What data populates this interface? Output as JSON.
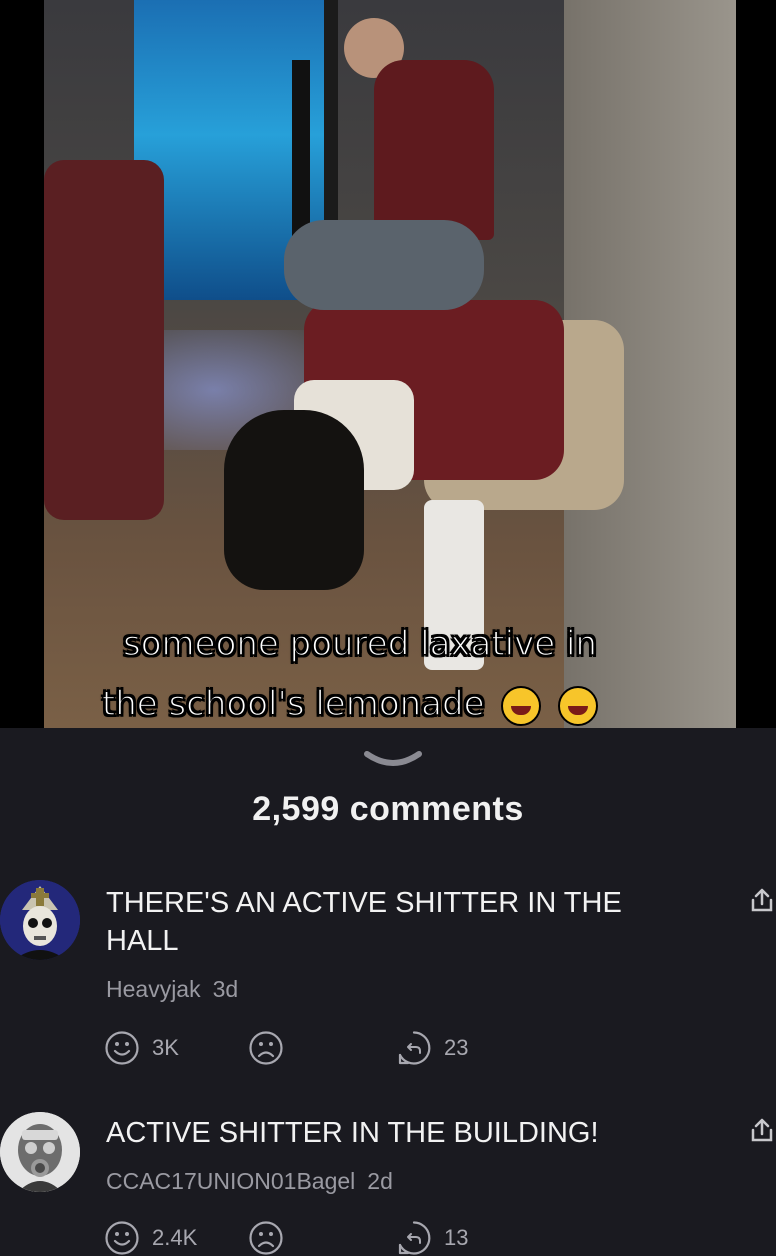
{
  "video": {
    "caption_line1": "someone poured laxative in",
    "caption_line2": "the school's lemonade",
    "caption_emoji": "laughing-face-emoji"
  },
  "comments_header": {
    "count_label": "2,599 comments",
    "icon": "chevron-down-icon"
  },
  "comments": [
    {
      "text_line1": "THERE'S AN ACTIVE SHITTER IN THE",
      "text_line2": "HALL",
      "author": "Heavyjak",
      "time": "3d",
      "likes": "3K",
      "replies": "23",
      "avatar": "ghost-papa-avatar"
    },
    {
      "text_line1": "ACTIVE SHITTER IN THE BUILDING!",
      "author": "CCAC17UNION01Bagel",
      "time": "2d",
      "likes": "2.4K",
      "replies": "13",
      "avatar": "gasmask-avatar"
    }
  ],
  "colors": {
    "background": "#1a1a20",
    "text": "#f2f2f2",
    "muted": "#9a9aa2",
    "icon": "#a8a8b0"
  }
}
